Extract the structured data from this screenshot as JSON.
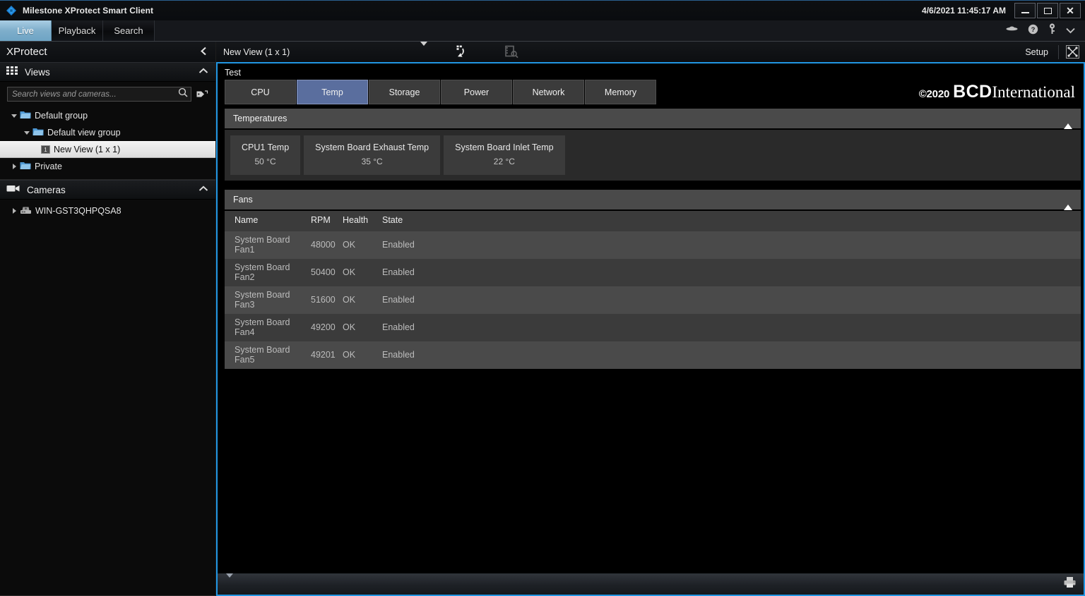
{
  "window": {
    "title": "Milestone XProtect Smart Client",
    "clock": "4/6/2021 11:45:17 AM",
    "minimize_label": "Minimize",
    "maximize_label": "Maximize",
    "close_label": "Close",
    "app_icon": "milestone-diamond-icon"
  },
  "modebar": {
    "tabs": [
      {
        "label": "Live",
        "active": true
      },
      {
        "label": "Playback",
        "active": false
      },
      {
        "label": "Search",
        "active": false
      }
    ],
    "icons": [
      "saucer-icon",
      "help-icon",
      "key-icon",
      "chevron-down-icon"
    ]
  },
  "sidebar": {
    "title": "XProtect",
    "collapse_icon": "chevron-left-icon",
    "views_panel": {
      "title": "Views",
      "icon": "grid-icon",
      "chevron": "chevron-up-icon",
      "search": {
        "placeholder": "Search views and cameras...",
        "value": "",
        "icon": "search-icon",
        "tag_icon": "tag-icon"
      },
      "tree": [
        {
          "label": "Default group",
          "level": 0,
          "expanded": true,
          "type": "folder",
          "selected": false
        },
        {
          "label": "Default view group",
          "level": 1,
          "expanded": true,
          "type": "folder",
          "selected": false
        },
        {
          "label": "New View (1 x 1)",
          "level": 2,
          "expanded": null,
          "type": "view",
          "selected": true,
          "badge": "1"
        },
        {
          "label": "Private",
          "level": 0,
          "expanded": false,
          "type": "folder",
          "selected": false
        }
      ]
    },
    "cameras_panel": {
      "title": "Cameras",
      "icon": "camera-icon",
      "chevron": "chevron-up-icon",
      "tree": [
        {
          "label": "WIN-GST3QHPQSA8",
          "level": 0,
          "expanded": false,
          "type": "server",
          "selected": false
        }
      ]
    }
  },
  "viewbar": {
    "view_name": "New View (1 x 1)",
    "caret_icon": "caret-down-icon",
    "reload_icon": "reload-view-icon",
    "search_clip_icon": "film-search-icon",
    "setup_label": "Setup",
    "fullscreen_icon": "fullscreen-icon"
  },
  "plugin": {
    "title": "Test",
    "tabs": [
      {
        "label": "CPU",
        "active": false
      },
      {
        "label": "Temp",
        "active": true
      },
      {
        "label": "Storage",
        "active": false
      },
      {
        "label": "Power",
        "active": false
      },
      {
        "label": "Network",
        "active": false
      },
      {
        "label": "Memory",
        "active": false
      }
    ],
    "brand": {
      "copyright": "©2020",
      "bold": "BCD",
      "serif": "International"
    },
    "sections": {
      "temperatures": {
        "title": "Temperatures",
        "collapse_icon": "triangle-up-icon",
        "cards": [
          {
            "name": "CPU1 Temp",
            "value": "50 °C"
          },
          {
            "name": "System Board Exhaust Temp",
            "value": "35 °C"
          },
          {
            "name": "System Board Inlet Temp",
            "value": "22 °C"
          }
        ]
      },
      "fans": {
        "title": "Fans",
        "collapse_icon": "triangle-up-icon",
        "columns": [
          "Name",
          "RPM",
          "Health",
          "State"
        ],
        "rows": [
          {
            "name": "System Board Fan1",
            "rpm": "48000",
            "health": "OK",
            "state": "Enabled"
          },
          {
            "name": "System Board Fan2",
            "rpm": "50400",
            "health": "OK",
            "state": "Enabled"
          },
          {
            "name": "System Board Fan3",
            "rpm": "51600",
            "health": "OK",
            "state": "Enabled"
          },
          {
            "name": "System Board Fan4",
            "rpm": "49200",
            "health": "OK",
            "state": "Enabled"
          },
          {
            "name": "System Board Fan5",
            "rpm": "49201",
            "health": "OK",
            "state": "Enabled"
          }
        ]
      }
    }
  },
  "footer": {
    "expand_icon": "chevron-down-icon",
    "print_icon": "printer-icon"
  },
  "colors": {
    "accent_blue": "#2196e3",
    "active_tab_blue": "#5a6e9e",
    "live_tab_blue": "#7eaecb",
    "panel_gray": "#4a4a4a",
    "card_gray": "#3b3b3b"
  }
}
